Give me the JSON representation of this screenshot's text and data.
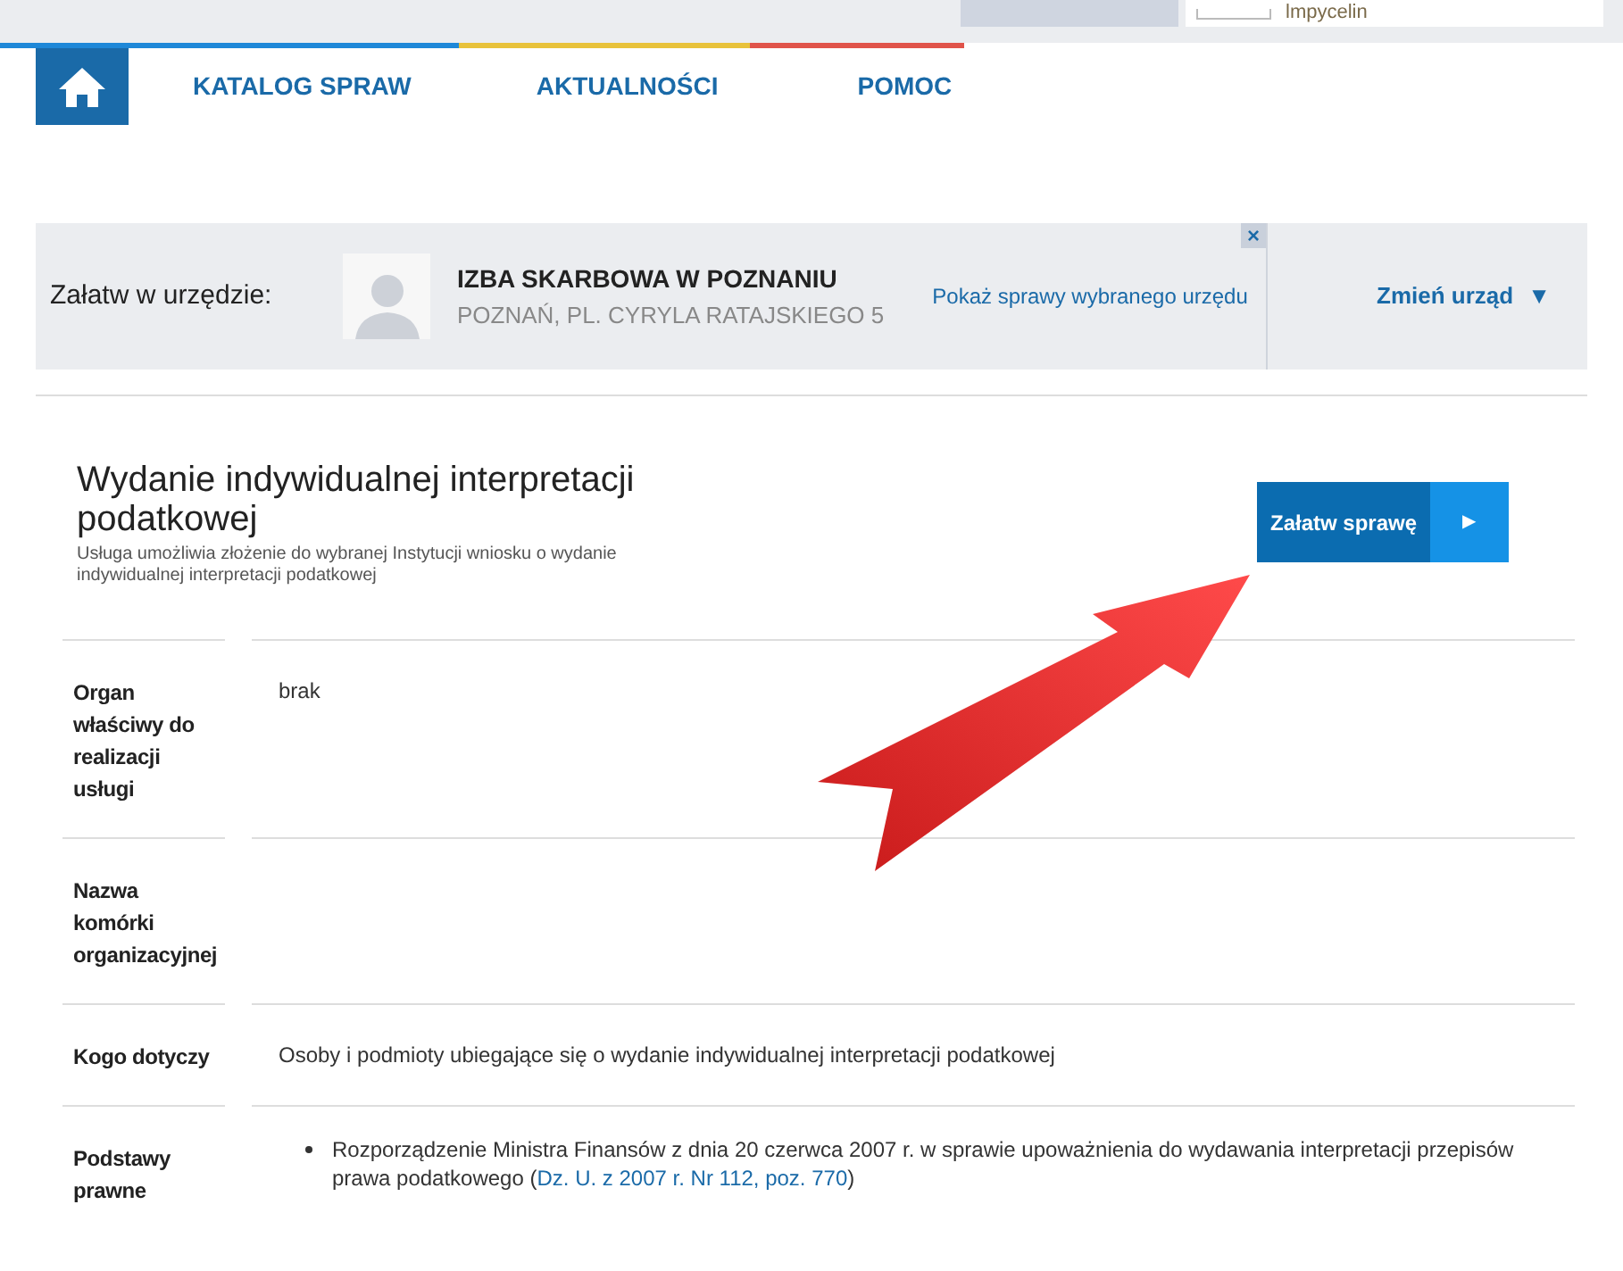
{
  "top_bar": {
    "field_text": "lmpycelin"
  },
  "nav": {
    "items": [
      {
        "label": "KATALOG SPRAW",
        "color": "#1e88d8"
      },
      {
        "label": "AKTUALNOŚCI",
        "color": "#e8c23a"
      },
      {
        "label": "POMOC",
        "color": "#e0534a"
      }
    ]
  },
  "office": {
    "prompt": "Załatw w urzędzie:",
    "name": "IZBA SKARBOWA W POZNANIU",
    "address": "POZNAŃ, PL. CYRYLA RATAJSKIEGO 5",
    "link": "Pokaż sprawy wybranego urzędu",
    "close": "×",
    "change": "Zmień urząd",
    "change_caret": "▼"
  },
  "service": {
    "title": "Wydanie indywidualnej interpretacji podatkowej",
    "description": "Usługa umożliwia złożenie do wybranej Instytucji wniosku o wydanie indywidualnej interpretacji podatkowej",
    "button": "Załatw sprawę",
    "button_arrow": "▶"
  },
  "details": [
    {
      "label": "Organ właściwy do realizacji usługi",
      "kind": "text",
      "value": "brak"
    },
    {
      "label": "Nazwa komórki organizacyjnej",
      "kind": "text"
    },
    {
      "label": "Kogo dotyczy",
      "kind": "text",
      "value": "Osoby i podmioty ubiegające się o wydanie indywidualnej interpretacji podatkowej"
    },
    {
      "label": "Podstawy prawne",
      "kind": "list",
      "items": [
        {
          "text": "Rozporządzenie Ministra Finansów z dnia 20 czerwca 2007 r. w sprawie upoważnienia do wydawania interpretacji przepisów prawa podatkowego (",
          "link": "Dz. U. z 2007 r. Nr 112, poz. 770",
          "after": ")"
        }
      ]
    }
  ]
}
